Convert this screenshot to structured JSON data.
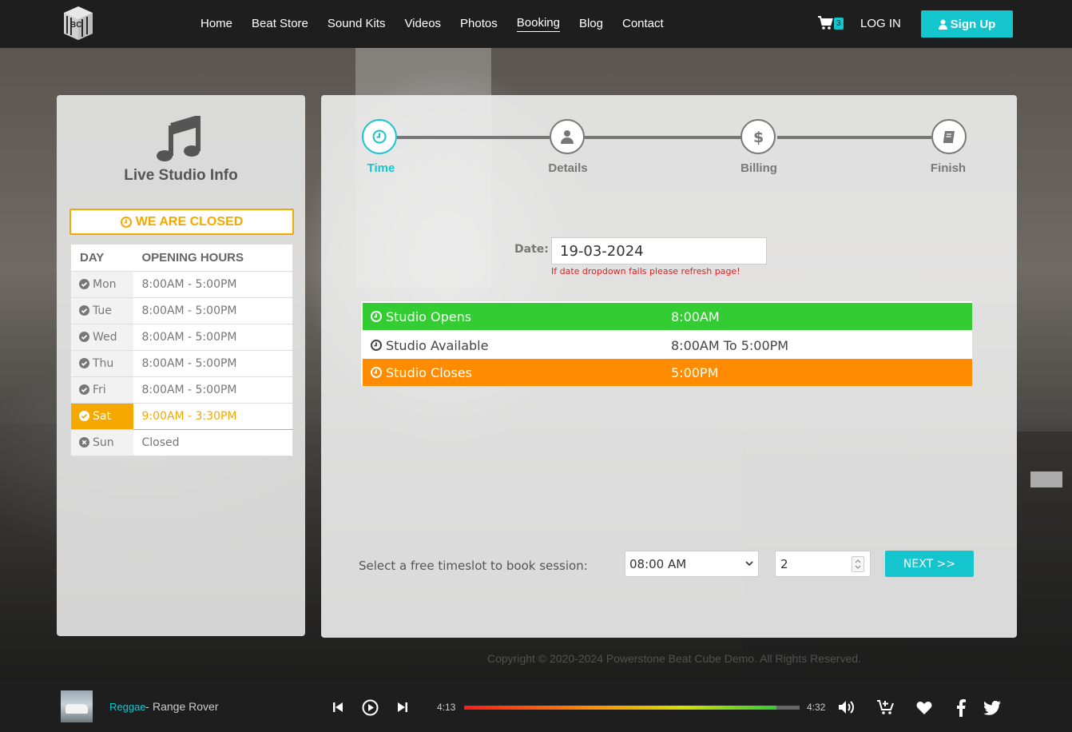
{
  "nav": {
    "logo_text": "BC",
    "links": [
      {
        "label": "Home"
      },
      {
        "label": "Beat Store"
      },
      {
        "label": "Sound Kits"
      },
      {
        "label": "Videos"
      },
      {
        "label": "Photos"
      },
      {
        "label": "Booking",
        "active": true
      },
      {
        "label": "Blog"
      },
      {
        "label": "Contact"
      }
    ],
    "cart_count": "3",
    "login_label": "LOG IN",
    "signup_label": "Sign Up"
  },
  "studio_info": {
    "title": "Live Studio Info",
    "status": "WE ARE CLOSED",
    "table_headers": {
      "day": "DAY",
      "hours": "OPENING HOURS"
    },
    "days": [
      {
        "day": "Mon",
        "hours": "8:00AM - 5:00PM"
      },
      {
        "day": "Tue",
        "hours": "8:00AM - 5:00PM"
      },
      {
        "day": "Wed",
        "hours": "8:00AM - 5:00PM"
      },
      {
        "day": "Thu",
        "hours": "8:00AM - 5:00PM"
      },
      {
        "day": "Fri",
        "hours": "8:00AM - 5:00PM"
      },
      {
        "day": "Sat",
        "hours": "9:00AM - 3:30PM",
        "today": true
      },
      {
        "day": "Sun",
        "hours": "Closed",
        "closed": true
      }
    ]
  },
  "booking": {
    "steps": [
      {
        "label": "Time",
        "icon": "clock-icon",
        "active": true
      },
      {
        "label": "Details",
        "icon": "user-icon"
      },
      {
        "label": "Billing",
        "icon": "dollar-icon"
      },
      {
        "label": "Finish",
        "icon": "book-icon"
      }
    ],
    "date_label": "Date:",
    "date_value": "19-03-2024",
    "date_warning": "If date dropdown fails please refresh page!",
    "slots": [
      {
        "label": "Studio Opens",
        "value": "8:00AM"
      },
      {
        "label": "Studio Available",
        "value": "8:00AM To 5:00PM"
      },
      {
        "label": "Studio Closes",
        "value": "5:00PM"
      }
    ],
    "book_label": "Select a free timeslot to book session:",
    "time_selected": "08:00 AM",
    "hours_value": "2",
    "next_label": "NEXT >>"
  },
  "footer": {
    "copyright": "Copyright © 2020-2024 Powerstone Beat Cube Demo. All Rights Reserved."
  },
  "player": {
    "genre": "Reggae",
    "separator": "-",
    "track": "Range Rover",
    "time_current": "4:13",
    "time_total": "4:32",
    "progress": 0.93
  },
  "colors": {
    "accent": "#15c5cd",
    "closed_orange": "#f5a800",
    "open_green": "#33cc33",
    "closes_orange": "#ff8c00"
  }
}
